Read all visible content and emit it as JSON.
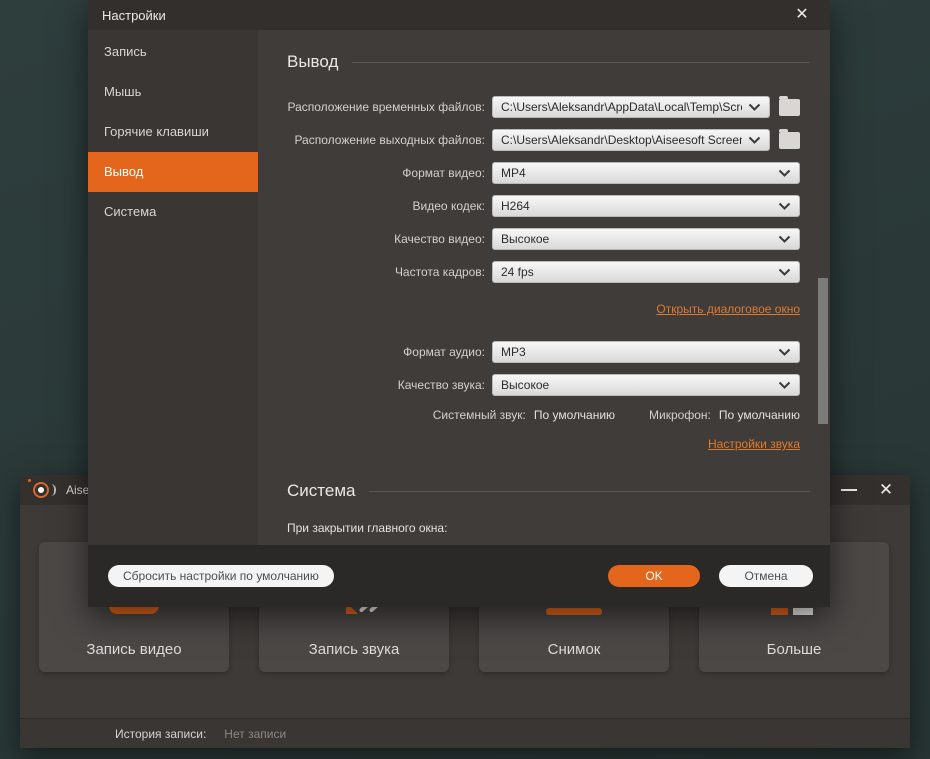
{
  "icons": {
    "close": "✕"
  },
  "colors": {
    "accent": "#e4661c",
    "link": "#e07a2e",
    "desktop": "#2d3c3b",
    "dialog_bg": "#403c39"
  },
  "dialog": {
    "title": "Настройки",
    "sidebar": {
      "items": [
        {
          "label": "Запись"
        },
        {
          "label": "Мышь"
        },
        {
          "label": "Горячие клавиши"
        },
        {
          "label": "Вывод",
          "selected": true
        },
        {
          "label": "Система"
        }
      ]
    },
    "output": {
      "heading": "Вывод",
      "rows": [
        {
          "label": "Расположение временных файлов:",
          "value": "C:\\Users\\Aleksandr\\AppData\\Local\\Temp\\Screen R"
        },
        {
          "label": "Расположение выходных файлов:",
          "value": "C:\\Users\\Aleksandr\\Desktop\\Aiseesoft Screen Rec"
        },
        {
          "label": "Формат видео:",
          "value": "MP4"
        },
        {
          "label": "Видео кодек:",
          "value": "H264"
        },
        {
          "label": "Качество видео:",
          "value": "Высокое"
        },
        {
          "label": "Частота кадров:",
          "value": "24 fps"
        }
      ],
      "open_dialog_link": "Открыть диалоговое окно",
      "audio_rows": [
        {
          "label": "Формат аудио:",
          "value": "MP3"
        },
        {
          "label": "Качество звука:",
          "value": "Высокое"
        }
      ],
      "system_sound_label": "Системный звук:",
      "system_sound_value": "По умолчанию",
      "mic_label": "Микрофон:",
      "mic_value": "По умолчанию",
      "sound_settings_link": "Настройки звука"
    },
    "system": {
      "heading": "Система",
      "close_behavior_label": "При закрытии главного окна:"
    },
    "footer": {
      "reset_label": "Сбросить настройки по умолчанию",
      "ok_label": "OK",
      "cancel_label": "Отмена"
    }
  },
  "main_window": {
    "title": "Aisees",
    "cards": [
      {
        "label": "Запись видео"
      },
      {
        "label": "Запись звука"
      },
      {
        "label": "Снимок"
      },
      {
        "label": "Больше"
      }
    ],
    "history_label": "История записи:",
    "history_value": "Нет записи"
  }
}
